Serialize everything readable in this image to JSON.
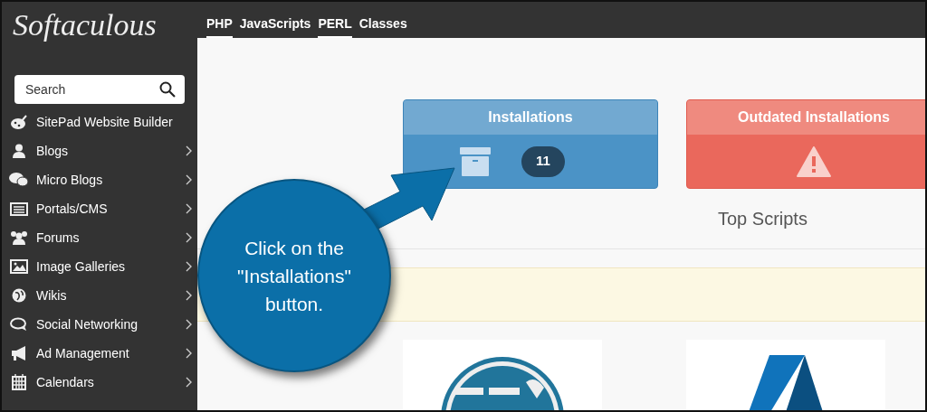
{
  "logo": "Softaculous",
  "nav_tabs": [
    {
      "label": "PHP",
      "selected": true
    },
    {
      "label": "JavaScripts",
      "selected": false
    },
    {
      "label": "PERL",
      "selected": true
    },
    {
      "label": "Classes",
      "selected": false
    }
  ],
  "search": {
    "placeholder": "Search"
  },
  "sidebar": {
    "items": [
      {
        "label": "SitePad Website Builder",
        "has_submenu": false
      },
      {
        "label": "Blogs",
        "has_submenu": true
      },
      {
        "label": "Micro Blogs",
        "has_submenu": true
      },
      {
        "label": "Portals/CMS",
        "has_submenu": true
      },
      {
        "label": "Forums",
        "has_submenu": true
      },
      {
        "label": "Image Galleries",
        "has_submenu": true
      },
      {
        "label": "Wikis",
        "has_submenu": true
      },
      {
        "label": "Social Networking",
        "has_submenu": true
      },
      {
        "label": "Ad Management",
        "has_submenu": true
      },
      {
        "label": "Calendars",
        "has_submenu": true
      }
    ]
  },
  "cards": [
    {
      "kind": "installations",
      "title": "Installations",
      "count": "11"
    },
    {
      "kind": "outdated",
      "title": "Outdated Installations"
    }
  ],
  "section_title": "Top Scripts",
  "callout": {
    "text": "Click on the \"Installations\" button."
  }
}
